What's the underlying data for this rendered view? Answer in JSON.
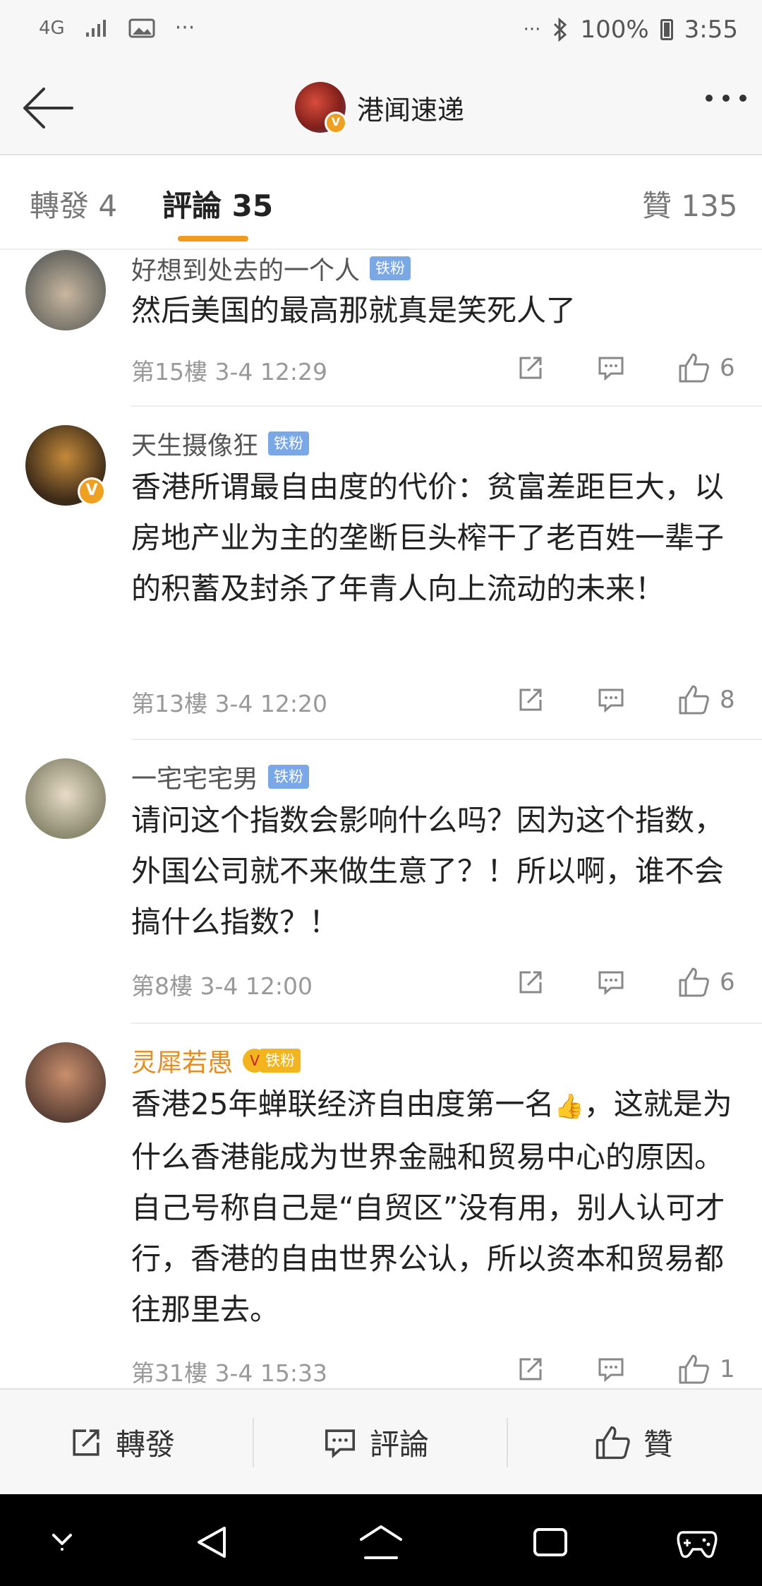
{
  "status_bar": {
    "network": "4G",
    "icons": [
      "signal-icon",
      "image-icon",
      "more-icon",
      "bluetooth-icon",
      "battery-icon"
    ],
    "overflow": "···",
    "battery": "100%",
    "time": "3:55"
  },
  "header": {
    "title": "港闻速递",
    "verified": "V"
  },
  "tabs": [
    {
      "label": "轉發 4"
    },
    {
      "label": "評論 35"
    },
    {
      "label": "贊 135"
    }
  ],
  "comments": [
    {
      "user": "好想到处去的一个人",
      "badge": "铁粉",
      "text": "然后美国的最高那就真是笑死人了",
      "floor_time": "第15樓 3-4 12:29",
      "likes": "6"
    },
    {
      "user": "天生摄像狂",
      "badge": "铁粉",
      "verified": "V",
      "text": "香港所谓最自由度的代价：贫富差距巨大，以房地产业为主的垄断巨头榨干了老百姓一辈子的积蓄及封杀了年青人向上流动的未来！",
      "floor_time": "第13樓 3-4 12:20",
      "likes": "8"
    },
    {
      "user": "一宅宅宅男",
      "badge": "铁粉",
      "text": "请问这个指数会影响什么吗？因为这个指数，外国公司就不来做生意了？！所以啊，谁不会搞什么指数？！",
      "floor_time": "第8樓 3-4 12:00",
      "likes": "6"
    },
    {
      "user": "灵犀若愚",
      "badge": "铁粉",
      "crown": "V",
      "text_before": "香港25年蝉联经济自由度第一名",
      "emoji": "👍",
      "text_after": "，这就是为什么香港能成为世界金融和贸易中心的原因。自己号称自己是“自贸区”没有用，别人认可才行，香港的自由世界公认，所以资本和贸易都往那里去。",
      "floor_time": "第31樓 3-4 15:33",
      "likes": "1"
    }
  ],
  "bottom_bar": {
    "repost": "轉發",
    "comment": "評論",
    "like": "贊"
  },
  "colors": {
    "accent": "#f29a1a",
    "badge_blue": "#7aa8e6",
    "gold_name": "#e98c1c"
  }
}
